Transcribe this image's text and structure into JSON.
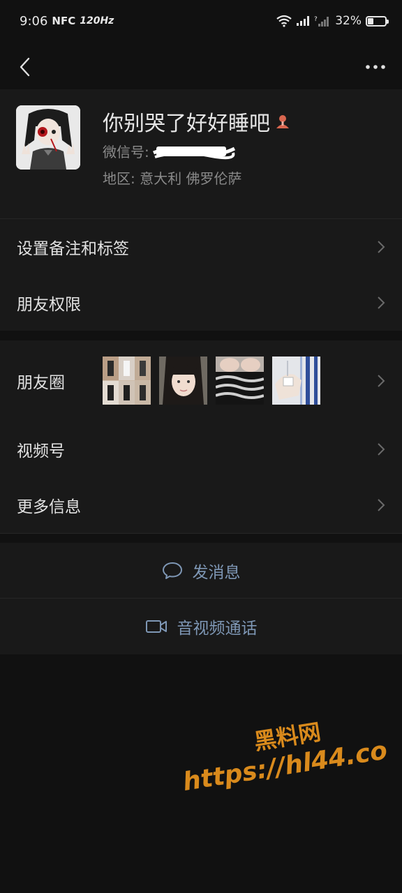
{
  "status_bar": {
    "time": "9:06",
    "nfc": "NFC",
    "refresh": "120Hz",
    "battery_percent": "32%",
    "battery_level": 0.32
  },
  "nav": {
    "back_icon": "back-chevron-icon",
    "more_icon": "more-dots-icon"
  },
  "profile": {
    "name": "你别哭了好好睡吧",
    "wechat_label": "微信号:",
    "region": "地区: 意大利  佛罗伦萨"
  },
  "menu": {
    "remark_tags": "设置备注和标签",
    "friend_permissions": "朋友权限",
    "moments": "朋友圈",
    "channels": "视频号",
    "more_info": "更多信息"
  },
  "actions": {
    "send_message": "发消息",
    "video_call": "音视频通话"
  },
  "watermark": {
    "title": "黑料网",
    "url": "https://hl44.co"
  },
  "colors": {
    "background": "#111111",
    "panel": "#191919",
    "link_blue": "#7e97b5",
    "watermark": "#d98a1c"
  }
}
